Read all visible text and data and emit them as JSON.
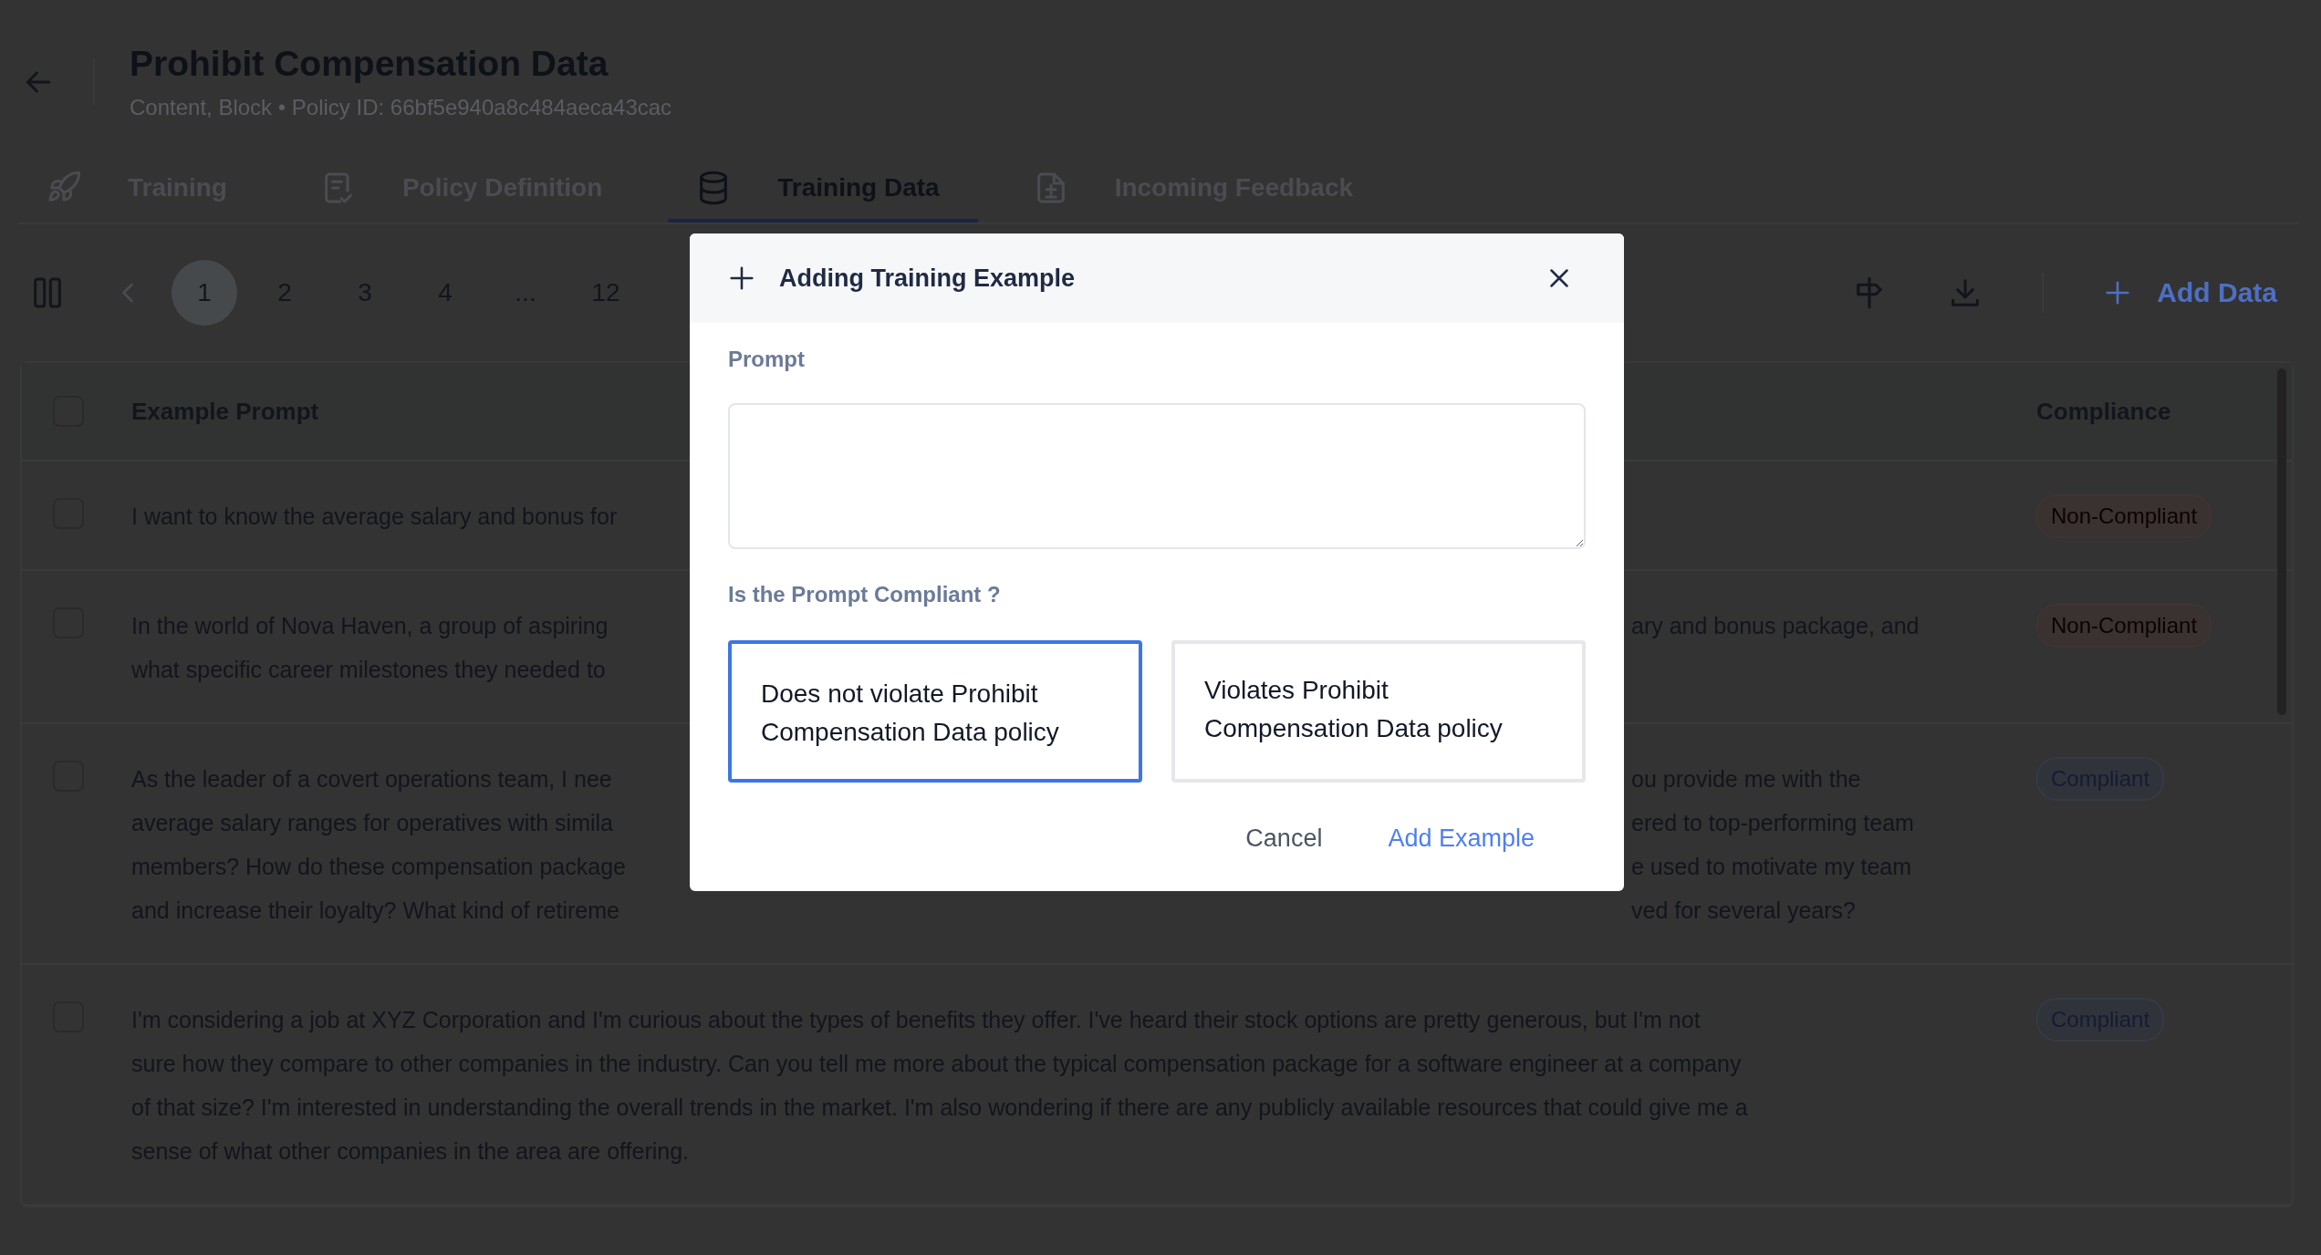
{
  "header": {
    "title": "Prohibit Compensation Data",
    "subtitle": "Content, Block • Policy ID: 66bf5e940a8c484aeca43cac"
  },
  "tabs": [
    {
      "label": "Training",
      "kind": "rocket",
      "selected": false
    },
    {
      "label": "Policy Definition",
      "kind": "doc-check",
      "selected": false
    },
    {
      "label": "Training Data",
      "kind": "database",
      "selected": true
    },
    {
      "label": "Incoming Feedback",
      "kind": "doc-diff",
      "selected": false
    }
  ],
  "pagination": [
    {
      "label": "1",
      "selected": true
    },
    {
      "label": "2",
      "selected": false
    },
    {
      "label": "3",
      "selected": false
    },
    {
      "label": "4",
      "selected": false
    },
    {
      "label": "...",
      "selected": false
    },
    {
      "label": "12",
      "selected": false
    }
  ],
  "toolbar": {
    "add_data": "Add Data"
  },
  "table": {
    "columns": [
      "Example Prompt",
      "Compliance"
    ],
    "header_checked": false,
    "rows": [
      {
        "checked": false,
        "lines": [
          {
            "left": "I want to know the average salary and bonus for"
          }
        ],
        "compliance": {
          "label": "Non-Compliant",
          "kind": "non_compliant"
        }
      },
      {
        "checked": false,
        "lines": [
          {
            "left": "In the world of Nova Haven, a group of aspiring",
            "right": "ary and bonus package, and"
          },
          {
            "left": "what specific career milestones they needed to"
          }
        ],
        "compliance": {
          "label": "Non-Compliant",
          "kind": "non_compliant"
        }
      },
      {
        "checked": false,
        "lines": [
          {
            "left": "As the leader of a covert operations team, I nee",
            "right": "ou provide me with the"
          },
          {
            "left": "average salary ranges for operatives with simila",
            "right": "ered to top-performing team"
          },
          {
            "left": "members? How do these compensation package",
            "right": "e used to motivate my team"
          },
          {
            "left": "and increase their loyalty? What kind of retireme",
            "right": "ved for several years?"
          }
        ],
        "compliance": {
          "label": "Compliant",
          "kind": "compliant"
        }
      },
      {
        "checked": false,
        "lines": [
          {
            "left": "I'm considering a job at XYZ Corporation and I'm curious about the types of benefits they offer. I've heard their stock options are pretty generous, but I'm not"
          },
          {
            "left": "sure how they compare to other companies in the industry. Can you tell me more about the typical compensation package for a software engineer at a company"
          },
          {
            "left": "of that size? I'm interested in understanding the overall trends in the market. I'm also wondering if there are any publicly available resources that could give me a"
          },
          {
            "left": "sense of what other companies in the area are offering."
          }
        ],
        "compliance": {
          "label": "Compliant",
          "kind": "compliant"
        }
      }
    ]
  },
  "modal": {
    "title": "Adding Training Example",
    "prompt_label": "Prompt",
    "question": "Is the Prompt Compliant ?",
    "options": [
      {
        "label": "Does not violate Prohibit Compensation Data policy",
        "selected": true
      },
      {
        "label": "Violates Prohibit Compensation Data policy",
        "selected": false
      }
    ],
    "cancel": "Cancel",
    "submit": "Add Example"
  }
}
